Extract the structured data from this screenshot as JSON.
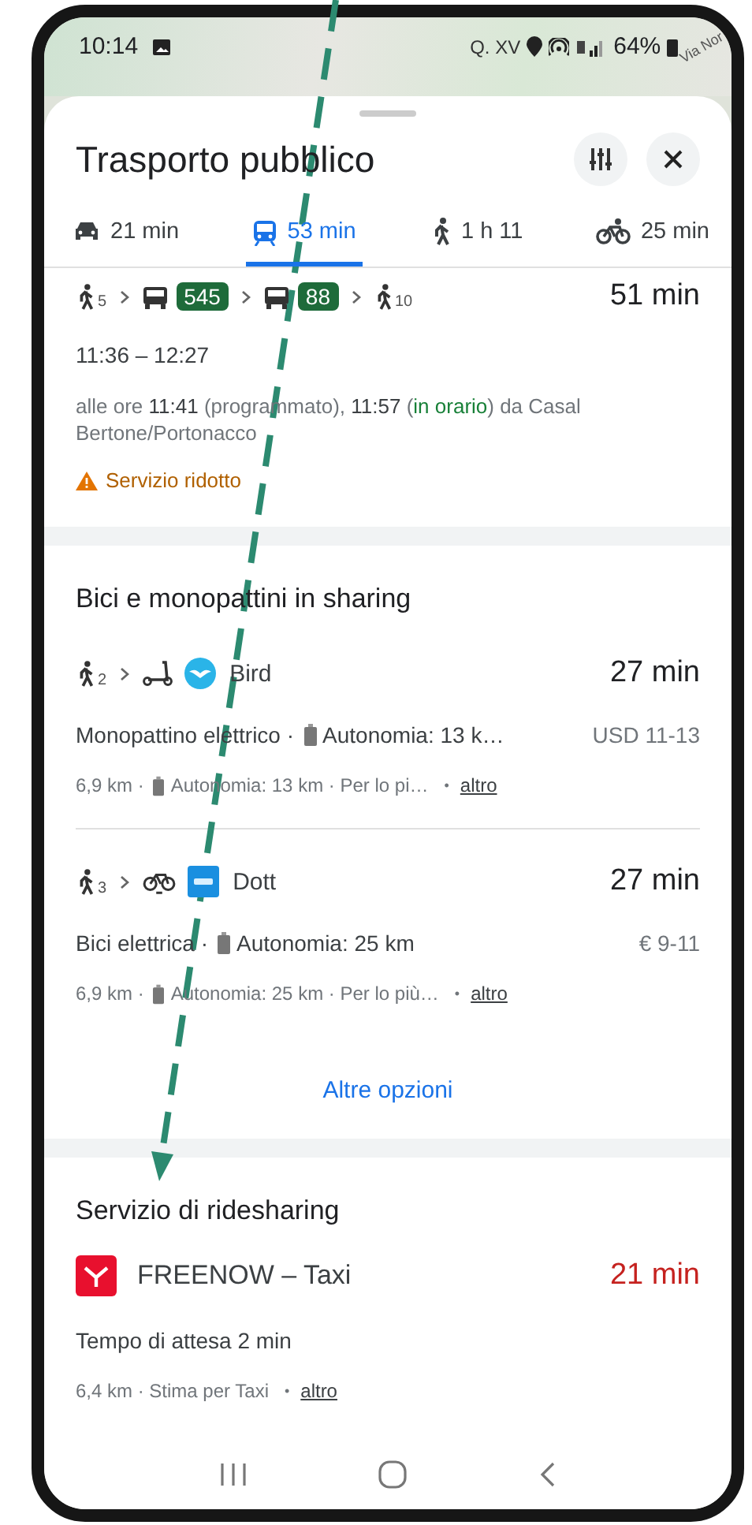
{
  "status_bar": {
    "time": "10:14",
    "battery": "64%"
  },
  "map_labels": [
    "Q. XV",
    "Via Nor"
  ],
  "sheet": {
    "title": "Trasporto pubblico"
  },
  "tabs": [
    {
      "kind": "car",
      "label": "21 min",
      "selected": false
    },
    {
      "kind": "transit",
      "label": "53 min",
      "selected": true
    },
    {
      "kind": "walk",
      "label": "1 h 11",
      "selected": false
    },
    {
      "kind": "bike",
      "label": "25 min",
      "selected": false
    }
  ],
  "transit_route": {
    "legs": [
      {
        "kind": "walk",
        "count": "5"
      },
      {
        "kind": "bus",
        "line": "545"
      },
      {
        "kind": "bus",
        "line": "88"
      },
      {
        "kind": "walk",
        "count": "10"
      }
    ],
    "duration": "51 min",
    "times": "11:36 – 12:27",
    "departures": [
      {
        "kind": "plain",
        "text": "alle ore **11:41** (programmato), **11:57** ("
      },
      {
        "kind": "on_time",
        "text": "in orario"
      },
      {
        "kind": "plain",
        "text": ") da Casal Bertone/Portonacco"
      }
    ],
    "alert": "Servizio ridotto"
  },
  "sharing_section": {
    "title": "Bici e monopattini in sharing",
    "options": [
      {
        "legs": [
          {
            "kind": "walk",
            "count": "2"
          },
          {
            "kind": "scooter"
          }
        ],
        "brand": {
          "kind": "bird",
          "name": "Bird"
        },
        "duration": "27 min",
        "summary": "Monopattino elettrico ·",
        "range": "Autonomia: 13 k…",
        "price": "USD 11-13",
        "distance": "6,9 km ·",
        "meta_range": "Autonomia: 13 km · Per lo pi…",
        "separator": "•",
        "more": "altro"
      },
      {
        "legs": [
          {
            "kind": "walk",
            "count": "3"
          },
          {
            "kind": "bike"
          }
        ],
        "brand": {
          "kind": "dott",
          "name": "Dott"
        },
        "duration": "27 min",
        "summary": "Bici elettrica ·",
        "range": "Autonomia: 25 km",
        "price": "€ 9-11",
        "distance": "6,9 km ·",
        "meta_range": "Autonomia: 25 km · Per lo più…",
        "separator": "•",
        "more": "altro"
      }
    ],
    "more_options": "Altre opzioni"
  },
  "ridesharing_section": {
    "title": "Servizio di ridesharing",
    "provider": "FREENOW – Taxi",
    "duration": "21 min",
    "wait": "Tempo di attesa 2 min",
    "meta": "6,4 km · Stima per Taxi",
    "separator": "•",
    "more": "altro"
  }
}
